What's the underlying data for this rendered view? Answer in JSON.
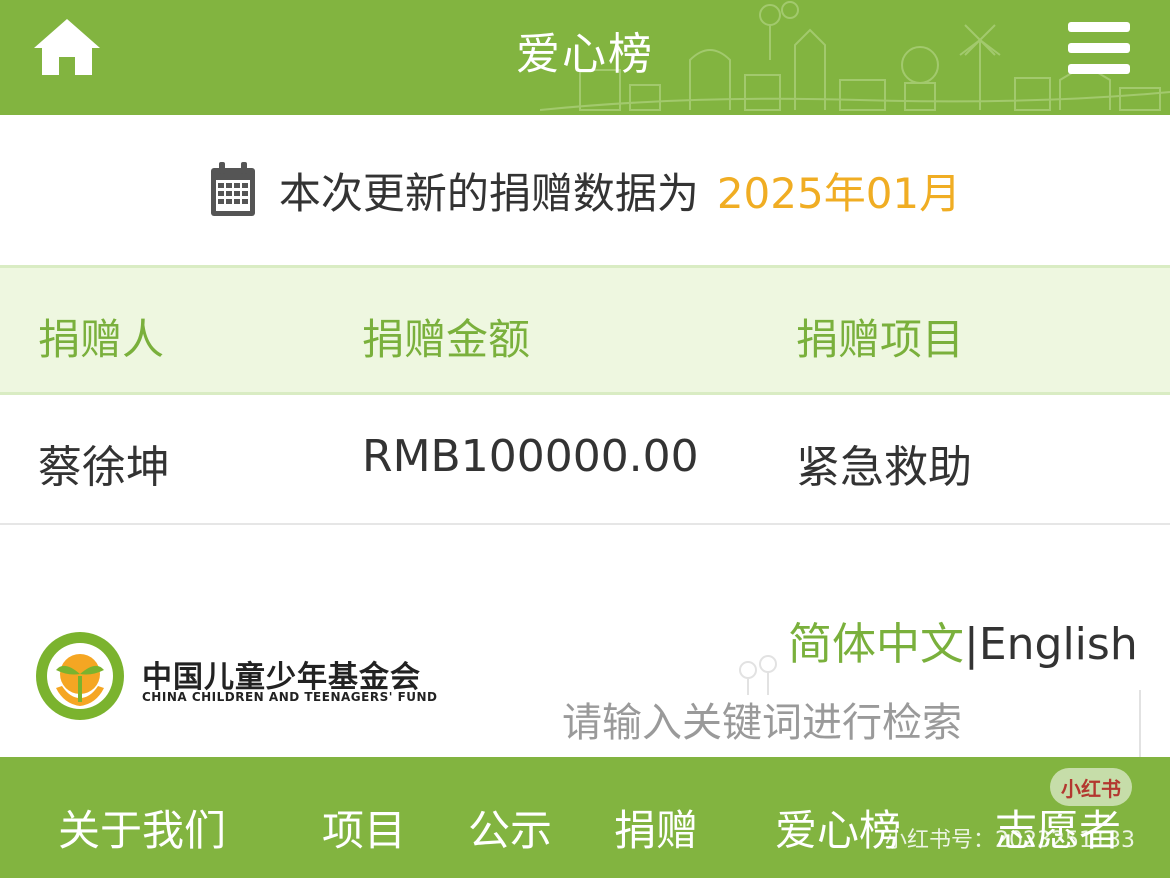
{
  "header": {
    "title": "爱心榜",
    "home_icon": "home-icon",
    "menu_icon": "hamburger-menu-icon",
    "bg_color": "#82b440"
  },
  "notice": {
    "icon": "calendar-icon",
    "text": "本次更新的捐赠数据为",
    "date": "2025年01月",
    "date_color": "#f0ad23"
  },
  "table": {
    "headers": [
      "捐赠人",
      "捐赠金额",
      "捐赠项目"
    ],
    "rows": [
      [
        "蔡徐坤",
        "RMB100000.00",
        "紧急救助"
      ]
    ]
  },
  "org": {
    "name_cn": "中国儿童少年基金会",
    "name_en": "CHINA CHILDREN AND TEENAGERS' FUND"
  },
  "language": {
    "zh": "简体中文",
    "separator": "|",
    "en": "English"
  },
  "search": {
    "placeholder": "请输入关键词进行检索"
  },
  "bottom_nav": [
    "关于我们",
    "项目",
    "公示",
    "捐赠",
    "爱心榜",
    "志愿者"
  ],
  "watermark": {
    "badge": "小红书",
    "text": "小红书号：2023251133"
  }
}
